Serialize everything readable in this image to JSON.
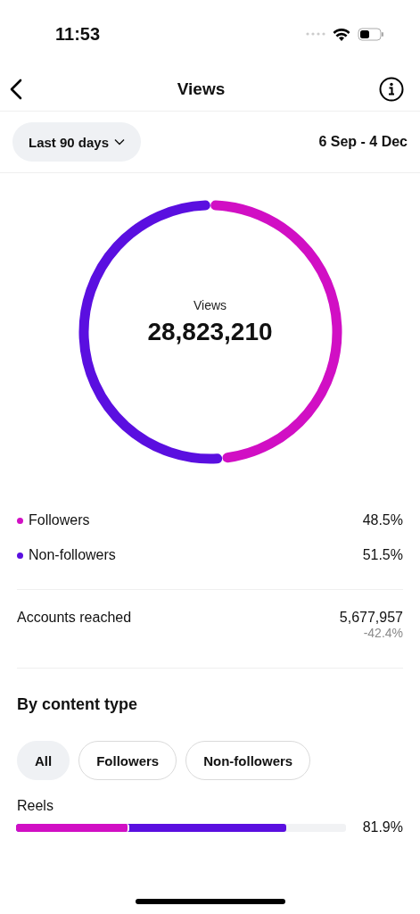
{
  "status_bar": {
    "time": "11:53"
  },
  "header": {
    "title": "Views"
  },
  "filter": {
    "range": "Last 90 days",
    "dates": "6 Sep - 4 Dec"
  },
  "summary": {
    "label": "Views",
    "value": "28,823,210"
  },
  "legend": [
    {
      "label": "Followers",
      "value": "48.5%",
      "color": "#d10fc4"
    },
    {
      "label": "Non-followers",
      "value": "51.5%",
      "color": "#5a0fe0"
    }
  ],
  "accounts": {
    "label": "Accounts reached",
    "value": "5,677,957",
    "change": "-42.4%"
  },
  "content_type": {
    "title": "By content type",
    "chips": [
      {
        "label": "All",
        "selected": true
      },
      {
        "label": "Followers",
        "selected": false
      },
      {
        "label": "Non-followers",
        "selected": false
      }
    ],
    "rows": [
      {
        "label": "Reels",
        "value": "81.9%",
        "segments": [
          {
            "color": "#d10fc4",
            "level": 0.343
          },
          {
            "color": "#5a0fe0",
            "level": 0.819
          }
        ]
      }
    ]
  }
}
